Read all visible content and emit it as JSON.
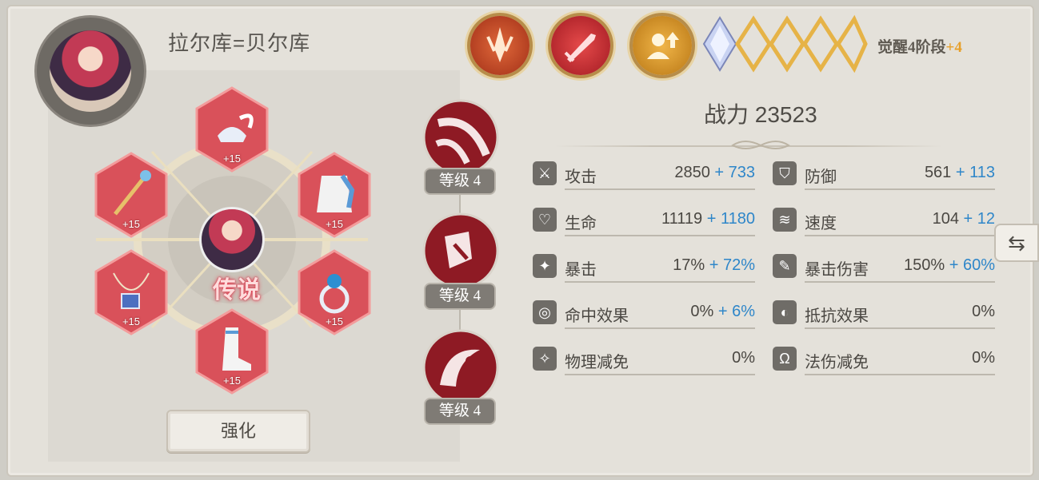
{
  "hero": {
    "name": "拉尔库=贝尔库",
    "rarity_label": "传说",
    "enhance_label": "强化"
  },
  "awakening": {
    "label": "觉醒4阶段",
    "bonus": "+4",
    "filled_stars": 1,
    "total_stars": 5
  },
  "equipment": [
    {
      "slot": "helmet",
      "level": "+15"
    },
    {
      "slot": "weapon",
      "level": "+15"
    },
    {
      "slot": "armor",
      "level": "+15"
    },
    {
      "slot": "necklace",
      "level": "+15"
    },
    {
      "slot": "ring",
      "level": "+15"
    },
    {
      "slot": "boots",
      "level": "+15"
    }
  ],
  "skills": [
    {
      "level_label": "等级 4"
    },
    {
      "level_label": "等级 4"
    },
    {
      "level_label": "等级 4"
    }
  ],
  "power": {
    "label": "战力 23523"
  },
  "stats_left": [
    {
      "icon": "sword-icon",
      "label": "攻击",
      "base": "2850",
      "bonus": "+ 733"
    },
    {
      "icon": "heart-icon",
      "label": "生命",
      "base": "11119",
      "bonus": "+ 1180"
    },
    {
      "icon": "crit-icon",
      "label": "暴击",
      "base": "17%",
      "bonus": "+ 72%"
    },
    {
      "icon": "target-icon",
      "label": "命中效果",
      "base": "0%",
      "bonus": "+ 6%"
    },
    {
      "icon": "phys-resist-icon",
      "label": "物理减免",
      "base": "0%",
      "bonus": ""
    }
  ],
  "stats_right": [
    {
      "icon": "shield-icon",
      "label": "防御",
      "base": "561",
      "bonus": "+ 113"
    },
    {
      "icon": "wind-icon",
      "label": "速度",
      "base": "104",
      "bonus": "+ 12"
    },
    {
      "icon": "crit-damage-icon",
      "label": "暴击伤害",
      "base": "150%",
      "bonus": "+ 60%"
    },
    {
      "icon": "resist-icon",
      "label": "抵抗效果",
      "base": "0%",
      "bonus": ""
    },
    {
      "icon": "magic-resist-icon",
      "label": "法伤减免",
      "base": "0%",
      "bonus": ""
    }
  ],
  "colors": {
    "accent_gold": "#e7a02b",
    "bonus_blue": "#2e86c9",
    "equip_red": "#d9515a"
  }
}
